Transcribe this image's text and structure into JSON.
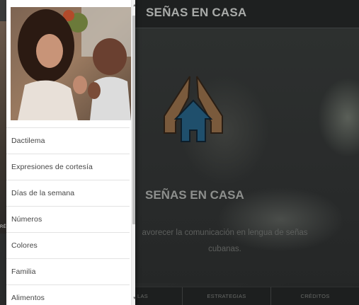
{
  "app": {
    "header_title": "SEÑAS EN CASA",
    "hero_title": "SEÑAS EN CASA",
    "hero_text": "avorecer la comunicación en lengua de señas cubanas.",
    "left_label": "RÉ",
    "bottom_nav": [
      "LAS",
      "ESTRATEGIAS",
      "CRÉDITOS"
    ]
  },
  "drawer": {
    "menu": [
      "Dactilema",
      "Expresiones de cortesía",
      "Días de la semana",
      "Números",
      "Colores",
      "Familia",
      "Alimentos"
    ]
  },
  "icons": {
    "logo": "house-hands-icon",
    "scroll_up": "scroll-up-arrow-icon",
    "scroll_down": "scroll-down-arrow-icon"
  },
  "colors": {
    "house_blue": "#2b6e96",
    "hands_tan": "#c48a55",
    "overlay_dark": "#2a2c2c"
  }
}
